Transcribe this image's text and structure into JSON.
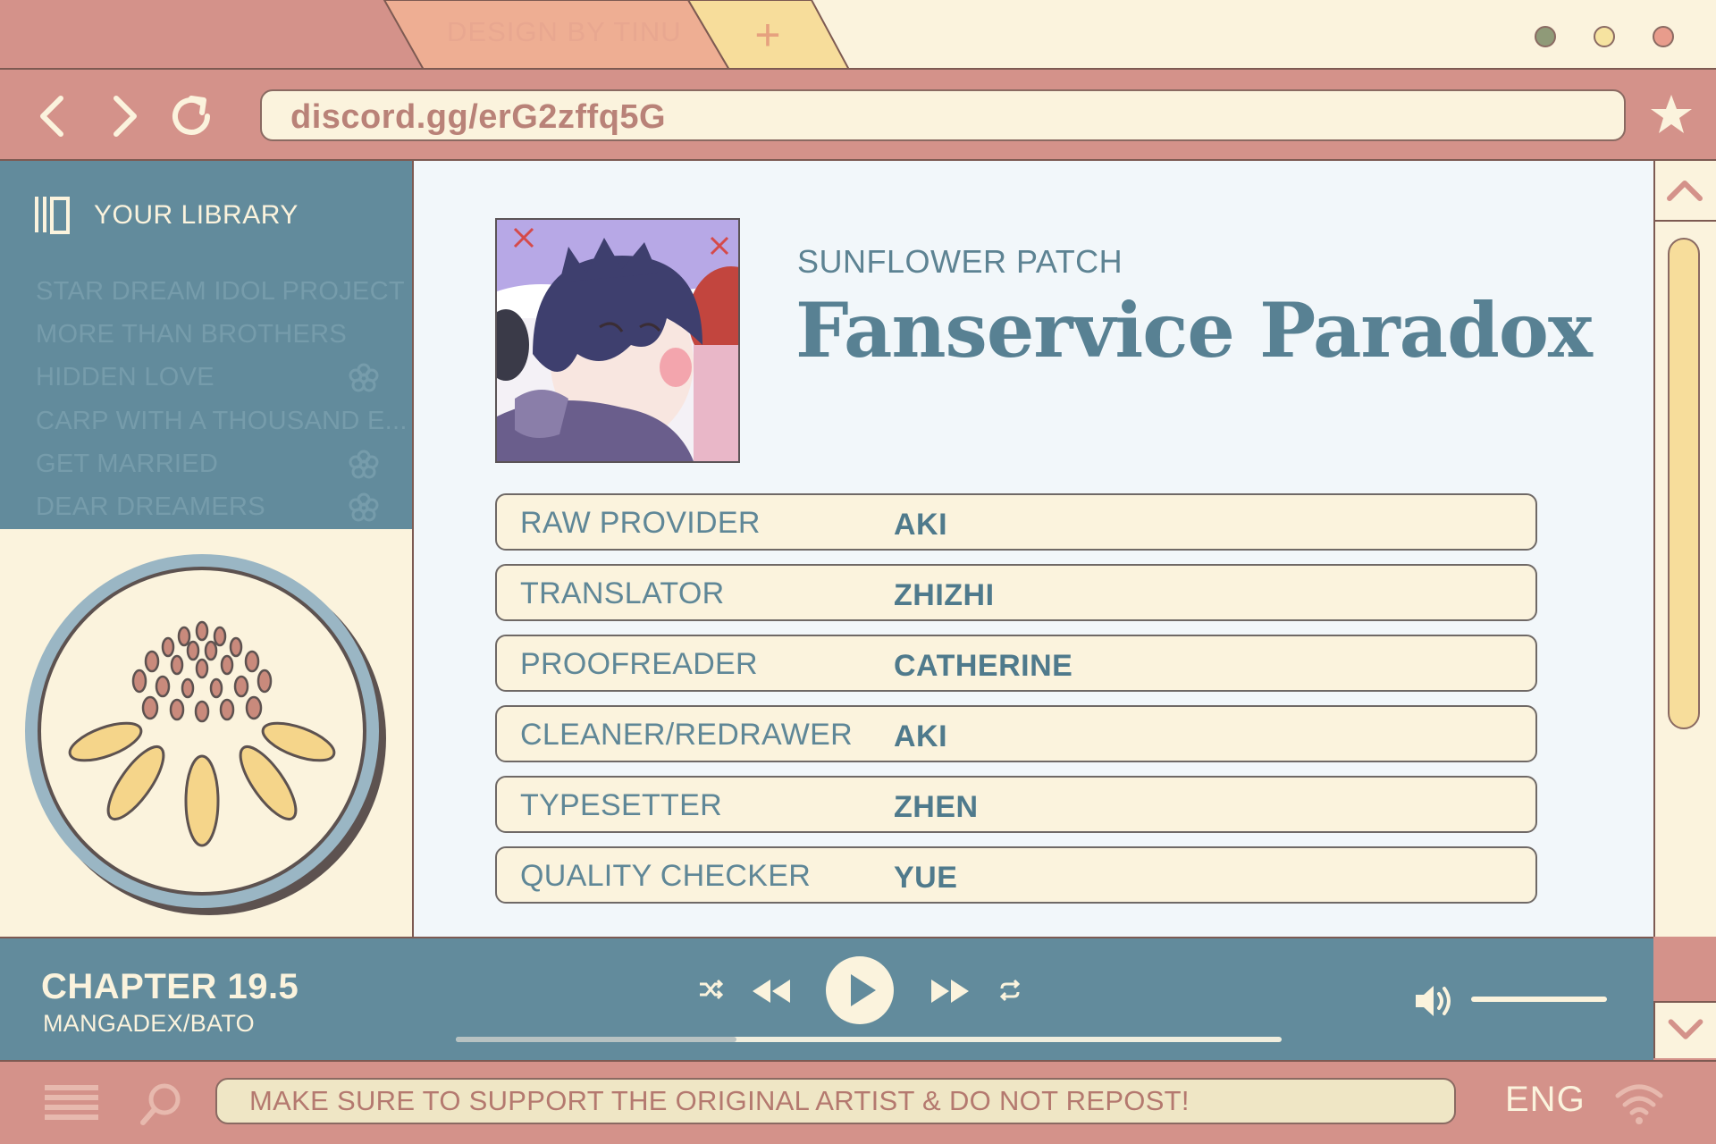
{
  "browser": {
    "tab_title": "DESIGN BY TINU",
    "new_tab_label": "+",
    "window_dots": [
      "#8f9a78",
      "#f6e3a0",
      "#e89c8c"
    ],
    "address": "discord.gg/erG2zffq5G"
  },
  "sidebar": {
    "title": "YOUR LIBRARY",
    "items": [
      {
        "label": "STAR DREAM IDOL PROJECT",
        "flower": false
      },
      {
        "label": "MORE THAN BROTHERS",
        "flower": false
      },
      {
        "label": "HIDDEN LOVE",
        "flower": true
      },
      {
        "label": "CARP WITH A THOUSAND E...",
        "flower": false
      },
      {
        "label": "GET MARRIED",
        "flower": true
      },
      {
        "label": "DEAR DREAMERS",
        "flower": true
      }
    ]
  },
  "main": {
    "group": "SUNFLOWER PATCH",
    "title": "Fanservice Paradox",
    "credits": [
      {
        "role": "RAW PROVIDER",
        "name": "AKI"
      },
      {
        "role": "TRANSLATOR",
        "name": "ZHIZHI"
      },
      {
        "role": "PROOFREADER",
        "name": "CATHERINE"
      },
      {
        "role": "CLEANER/REDRAWER",
        "name": "AKI"
      },
      {
        "role": "TYPESETTER",
        "name": "ZHEN"
      },
      {
        "role": "QUALITY CHECKER",
        "name": "YUE"
      }
    ]
  },
  "player": {
    "chapter": "CHAPTER 19.5",
    "source": "MANGADEX/BATO",
    "progress": 0.34,
    "controls": [
      "shuffle-icon",
      "rewind-icon",
      "play-icon",
      "fast-forward-icon",
      "repeat-icon"
    ],
    "volume": 1.0
  },
  "bottom": {
    "notice": "MAKE SURE TO SUPPORT THE ORIGINAL ARTIST & DO NOT REPOST!",
    "language": "ENG"
  },
  "colors": {
    "frame": "#d4928a",
    "cream": "#fbf3dd",
    "teal": "#628b9c",
    "outline": "#7d5a52",
    "sunflower": "#f5d58a"
  }
}
